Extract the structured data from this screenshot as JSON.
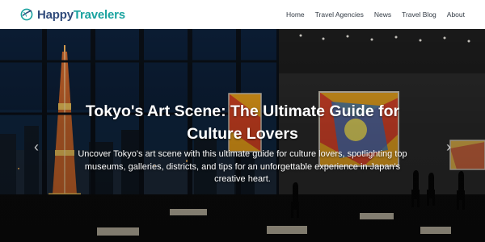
{
  "brand": {
    "name_part1": "Happy",
    "name_part2": "Travelers",
    "color_primary": "#2f4a7a",
    "color_accent": "#1aa3a0",
    "icon": "globe-plane-icon"
  },
  "nav": {
    "items": [
      {
        "label": "Home"
      },
      {
        "label": "Travel Agencies"
      },
      {
        "label": "News"
      },
      {
        "label": "Travel Blog"
      },
      {
        "label": "About"
      }
    ]
  },
  "hero": {
    "title": "Tokyo's Art Scene: The Ultimate Guide for Culture Lovers",
    "subtitle": "Uncover Tokyo's art scene with this ultimate guide for culture lovers, spotlighting top museums, galleries, districts, and tips for an unforgettable experience in Japan's creative heart.",
    "prev_icon": "chevron-left-icon",
    "next_icon": "chevron-right-icon"
  }
}
